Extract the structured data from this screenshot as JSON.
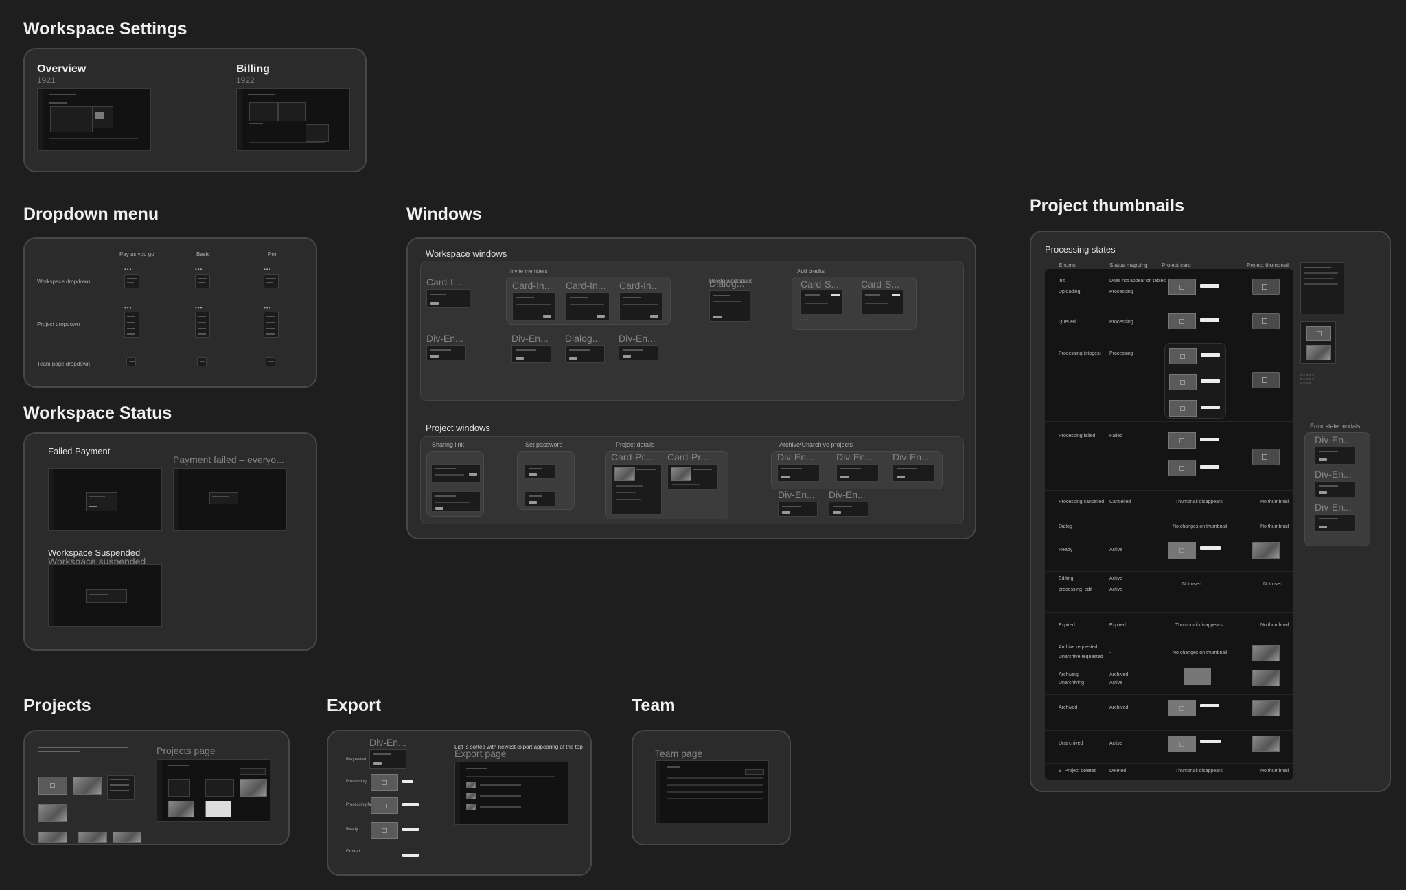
{
  "sections": {
    "workspace_settings": "Workspace Settings",
    "dropdown_menu": "Dropdown menu",
    "windows": "Windows",
    "project_thumbnails": "Project thumbnails",
    "workspace_status": "Workspace Status",
    "projects": "Projects",
    "export": "Export",
    "team": "Team"
  },
  "workspace_settings": {
    "overview": {
      "label": "Overview",
      "id": "1921"
    },
    "billing": {
      "label": "Billing",
      "id": "1922"
    }
  },
  "dropdown": {
    "cols": [
      "Pay as you go",
      "Basic",
      "Pro"
    ],
    "rows": [
      "Workspace dropdown",
      "Project dropdown",
      "Team page dropdown"
    ]
  },
  "windows": {
    "workspace_windows": "Workspace windows",
    "invite_members": "Invite members",
    "add_credits": "Add credits",
    "delete_workspace": "Delete workspace",
    "project_windows": "Project windows",
    "sharing_link": "Sharing link",
    "set_password": "Set password",
    "project_details": "Project details",
    "archive_projects": "Archive/Unarchive projects",
    "ghost": {
      "card_i": "Card-I...",
      "card_in": "Card-In...",
      "dialog_dots": "Dialog...",
      "card_s": "Card-S...",
      "div_en": "Div-En...",
      "dialog_g": "Dialog...",
      "card_pr": "Card-Pr..."
    }
  },
  "status": {
    "failed_payment": "Failed Payment",
    "failed_ghost": "Payment failed – everyo...",
    "suspended": "Workspace Suspended",
    "suspended_ghost": "Workspace suspended"
  },
  "projects": {
    "page": "Projects page"
  },
  "export": {
    "page": "Export page",
    "note": "List is sorted with newest export appearing at the top",
    "ghost": "Div-En...",
    "states": [
      "Requested",
      "Processing",
      "Processing failed",
      "Ready",
      "Expired"
    ]
  },
  "team": {
    "page": "Team page"
  },
  "thumbnails": {
    "processing_states": "Processing states",
    "error_state_modals": "Error state modals",
    "error_ghost": "Div-En...",
    "headers": [
      "Enums",
      "Status mapping",
      "Project card",
      "Project thumbnail"
    ],
    "rows": [
      {
        "enum": "init",
        "status": "Does not appear on tables"
      },
      {
        "enum": "Uploading",
        "status": "Processing"
      },
      {
        "enum": "Queued",
        "status": "Processing"
      },
      {
        "enum": "Processing (stages)",
        "status": "Processing"
      },
      {
        "enum": "Processing failed",
        "status": "Failed"
      },
      {
        "enum": "Processing cancelled",
        "status": "Cancelled",
        "card": "Thumbnail disappears",
        "thumb": "No thumbnail"
      },
      {
        "enum": "Dialog",
        "status": "-",
        "card": "No changes on thumbnail",
        "thumb": "No thumbnail"
      },
      {
        "enum": "Ready",
        "status": "Active"
      },
      {
        "enum": "Editing",
        "status": "Active",
        "card": "Not used",
        "thumb": "Not used"
      },
      {
        "enum": "processing_edit",
        "status": "Active"
      },
      {
        "enum": "Expired",
        "status": "Expired",
        "card": "Thumbnail disappears",
        "thumb": "No thumbnail"
      },
      {
        "enum": "Archive requested",
        "status": "-",
        "card": "No changes on thumbnail"
      },
      {
        "enum": "Unarchive requested",
        "status": ""
      },
      {
        "enum": "Archiving",
        "status": "Archived"
      },
      {
        "enum": "Unarchiving",
        "status": "Active"
      },
      {
        "enum": "Archived",
        "status": "Archived"
      },
      {
        "enum": "Unarchived",
        "status": "Active"
      },
      {
        "enum": "S_Project deleted",
        "status": "Deleted",
        "card": "Thumbnail disappears",
        "thumb": "No thumbnail"
      }
    ]
  }
}
